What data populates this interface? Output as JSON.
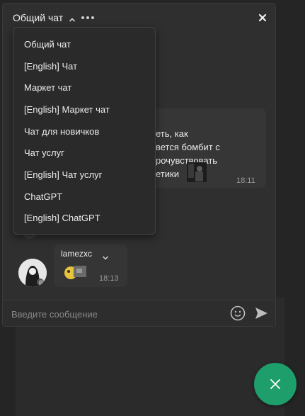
{
  "header": {
    "title": "Общий чат"
  },
  "dropdown": {
    "items": [
      {
        "label": "Общий чат"
      },
      {
        "label": "[English] Чат"
      },
      {
        "label": "Маркет чат"
      },
      {
        "label": "[English] Маркет чат"
      },
      {
        "label": "Чат для новичков"
      },
      {
        "label": "Чат услуг"
      },
      {
        "label": "[English] Чат услуг"
      },
      {
        "label": "ChatGPT"
      },
      {
        "label": "[English] ChatGPT"
      }
    ]
  },
  "messages": [
    {
      "lines": [
        "еть, как",
        "вется бомбит с",
        "рочувствовать",
        "етики"
      ],
      "time": "18:11"
    },
    {
      "username": "lamezxc",
      "time": "18:13"
    }
  ],
  "composer": {
    "placeholder": "Введите сообщение"
  },
  "icons": {
    "caret": "chevron-up-icon",
    "menu": "more-dots-icon",
    "close": "close-icon",
    "emoji": "smile-icon",
    "send": "send-icon",
    "fab": "close-icon"
  },
  "colors": {
    "accent": "#1e9e6a",
    "window": "#2f2f2f",
    "dropdown": "#2a2a2a"
  }
}
